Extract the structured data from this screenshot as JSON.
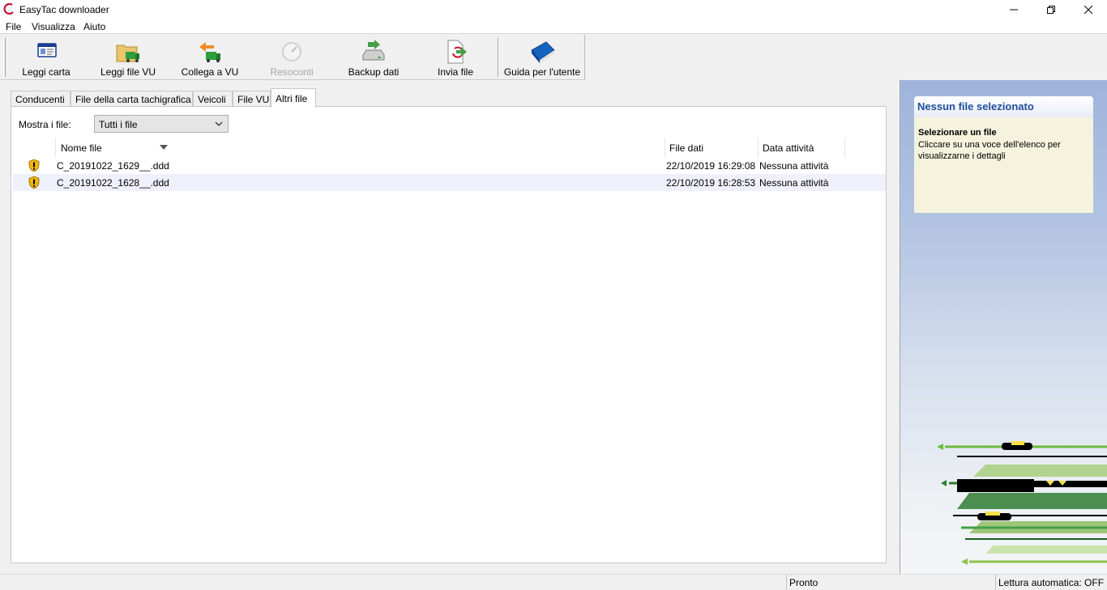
{
  "window": {
    "title": "EasyTac downloader"
  },
  "menu": {
    "items": [
      "File",
      "Visualizza",
      "Aiuto"
    ]
  },
  "toolbar": {
    "read_card": "Leggi carta",
    "read_vu": "Leggi file VU",
    "connect_vu": "Collega a VU",
    "reports": "Resoconti",
    "backup": "Backup dati",
    "send_file": "Invia file",
    "user_guide": "Guida per l'utente"
  },
  "tabs": [
    "Conducenti",
    "File della carta tachigrafica",
    "Veicoli",
    "File VU",
    "Altri file"
  ],
  "active_tab": "Altri file",
  "filter": {
    "label": "Mostra i file:",
    "selected": "Tutti i file"
  },
  "table": {
    "columns": {
      "name": "Nome file",
      "file_date": "File dati",
      "activity_date": "Data attività"
    },
    "rows": [
      {
        "name": "C_20191022_1629__.ddd",
        "file_date": "22/10/2019 16:29:08",
        "activity_date": "Nessuna attività"
      },
      {
        "name": "C_20191022_1628__.ddd",
        "file_date": "22/10/2019 16:28:53",
        "activity_date": "Nessuna attività"
      }
    ]
  },
  "info": {
    "title": "Nessun file selezionato",
    "subtitle": "Selezionare un file",
    "text": "Cliccare su una voce dell'elenco per visualizzarne i dettagli"
  },
  "status": {
    "ready": "Pronto",
    "auto_read": "Lettura automatica: OFF"
  },
  "colors": {
    "accent": "#1f4e99",
    "selected_row": "#eef0fb",
    "warning": "#f2b705"
  }
}
